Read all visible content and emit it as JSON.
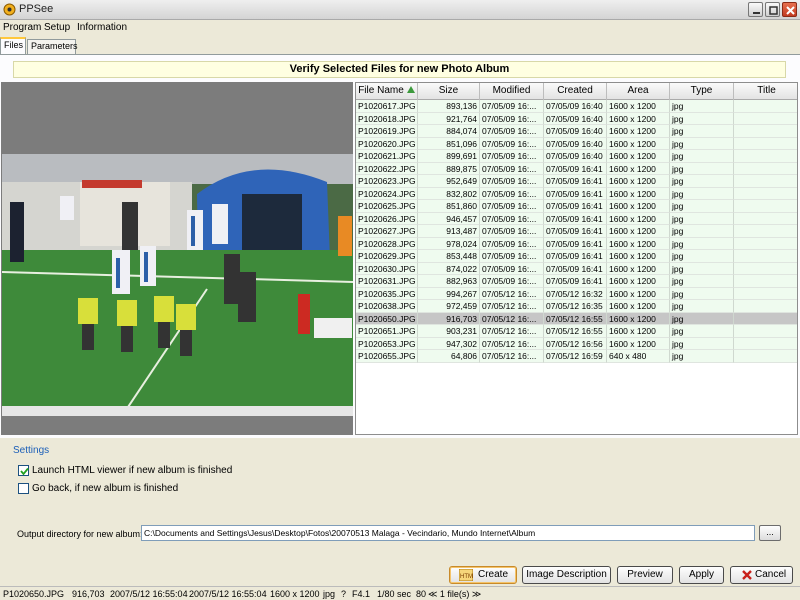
{
  "window": {
    "title": "PPSee"
  },
  "menu": [
    "Program",
    "Setup",
    "Information"
  ],
  "tabs": [
    "Files",
    "Parameters"
  ],
  "banner": "Verify Selected Files for new Photo Album",
  "table": {
    "columns": [
      "File Name",
      "Size",
      "Modified",
      "Created",
      "Area",
      "Type",
      "Title"
    ],
    "sort_column": "File Name",
    "sort_direction": "ascending",
    "rows": [
      {
        "name": "P1020617.JPG",
        "size": "893,136",
        "modified": "07/05/09 16:...",
        "created": "07/05/09 16:40",
        "area": "1600 x 1200",
        "type": "jpg",
        "title": ""
      },
      {
        "name": "P1020618.JPG",
        "size": "921,764",
        "modified": "07/05/09 16:...",
        "created": "07/05/09 16:40",
        "area": "1600 x 1200",
        "type": "jpg",
        "title": ""
      },
      {
        "name": "P1020619.JPG",
        "size": "884,074",
        "modified": "07/05/09 16:...",
        "created": "07/05/09 16:40",
        "area": "1600 x 1200",
        "type": "jpg",
        "title": ""
      },
      {
        "name": "P1020620.JPG",
        "size": "851,096",
        "modified": "07/05/09 16:...",
        "created": "07/05/09 16:40",
        "area": "1600 x 1200",
        "type": "jpg",
        "title": ""
      },
      {
        "name": "P1020621.JPG",
        "size": "899,691",
        "modified": "07/05/09 16:...",
        "created": "07/05/09 16:40",
        "area": "1600 x 1200",
        "type": "jpg",
        "title": ""
      },
      {
        "name": "P1020622.JPG",
        "size": "889,875",
        "modified": "07/05/09 16:...",
        "created": "07/05/09 16:41",
        "area": "1600 x 1200",
        "type": "jpg",
        "title": ""
      },
      {
        "name": "P1020623.JPG",
        "size": "952,649",
        "modified": "07/05/09 16:...",
        "created": "07/05/09 16:41",
        "area": "1600 x 1200",
        "type": "jpg",
        "title": ""
      },
      {
        "name": "P1020624.JPG",
        "size": "832,802",
        "modified": "07/05/09 16:...",
        "created": "07/05/09 16:41",
        "area": "1600 x 1200",
        "type": "jpg",
        "title": ""
      },
      {
        "name": "P1020625.JPG",
        "size": "851,860",
        "modified": "07/05/09 16:...",
        "created": "07/05/09 16:41",
        "area": "1600 x 1200",
        "type": "jpg",
        "title": ""
      },
      {
        "name": "P1020626.JPG",
        "size": "946,457",
        "modified": "07/05/09 16:...",
        "created": "07/05/09 16:41",
        "area": "1600 x 1200",
        "type": "jpg",
        "title": ""
      },
      {
        "name": "P1020627.JPG",
        "size": "913,487",
        "modified": "07/05/09 16:...",
        "created": "07/05/09 16:41",
        "area": "1600 x 1200",
        "type": "jpg",
        "title": ""
      },
      {
        "name": "P1020628.JPG",
        "size": "978,024",
        "modified": "07/05/09 16:...",
        "created": "07/05/09 16:41",
        "area": "1600 x 1200",
        "type": "jpg",
        "title": ""
      },
      {
        "name": "P1020629.JPG",
        "size": "853,448",
        "modified": "07/05/09 16:...",
        "created": "07/05/09 16:41",
        "area": "1600 x 1200",
        "type": "jpg",
        "title": ""
      },
      {
        "name": "P1020630.JPG",
        "size": "874,022",
        "modified": "07/05/09 16:...",
        "created": "07/05/09 16:41",
        "area": "1600 x 1200",
        "type": "jpg",
        "title": ""
      },
      {
        "name": "P1020631.JPG",
        "size": "882,963",
        "modified": "07/05/09 16:...",
        "created": "07/05/09 16:41",
        "area": "1600 x 1200",
        "type": "jpg",
        "title": ""
      },
      {
        "name": "P1020635.JPG",
        "size": "994,267",
        "modified": "07/05/12 16:...",
        "created": "07/05/12 16:32",
        "area": "1600 x 1200",
        "type": "jpg",
        "title": ""
      },
      {
        "name": "P1020638.JPG",
        "size": "972,459",
        "modified": "07/05/12 16:...",
        "created": "07/05/12 16:35",
        "area": "1600 x 1200",
        "type": "jpg",
        "title": ""
      },
      {
        "name": "P1020650.JPG",
        "size": "916,703",
        "modified": "07/05/12 16:...",
        "created": "07/05/12 16:55",
        "area": "1600 x 1200",
        "type": "jpg",
        "title": "",
        "selected": true
      },
      {
        "name": "P1020651.JPG",
        "size": "903,231",
        "modified": "07/05/12 16:...",
        "created": "07/05/12 16:55",
        "area": "1600 x 1200",
        "type": "jpg",
        "title": ""
      },
      {
        "name": "P1020653.JPG",
        "size": "947,302",
        "modified": "07/05/12 16:...",
        "created": "07/05/12 16:56",
        "area": "1600 x 1200",
        "type": "jpg",
        "title": ""
      },
      {
        "name": "P1020655.JPG",
        "size": "64,806",
        "modified": "07/05/12 16:...",
        "created": "07/05/12 16:59",
        "area": "640 x 480",
        "type": "jpg",
        "title": ""
      }
    ]
  },
  "settings": {
    "label": "Settings",
    "launch_viewer": {
      "label": "Launch HTML viewer if new album is finished",
      "checked": true
    },
    "go_back": {
      "label": "Go back, if new album is finished",
      "checked": false
    },
    "output_label": "Output directory for new album:",
    "output_value": "C:\\Documents and Settings\\Jesus\\Desktop\\Fotos\\20070513 Malaga - Vecindario, Mundo Internet\\Album",
    "browse_label": "..."
  },
  "buttons": {
    "create": "Create",
    "image_description": "Image Description",
    "preview": "Preview",
    "apply": "Apply",
    "cancel": "Cancel"
  },
  "status": {
    "file": "P1020650.JPG",
    "size": "916,703",
    "modified": "2007/5/12 16:55:04",
    "created": "2007/5/12 16:55:04",
    "area": "1600 x 1200",
    "type": "jpg",
    "unknown": "?",
    "aperture": "F4.1",
    "shutter": "1/80 sec",
    "iso": "80",
    "files": "≪ 1 file(s) ≫"
  },
  "colors": {
    "selected_row": "#c6c6c6",
    "row_bg": "#effbef",
    "banner_bg": "#ffffe1",
    "settings_label": "#1c5fb8"
  }
}
